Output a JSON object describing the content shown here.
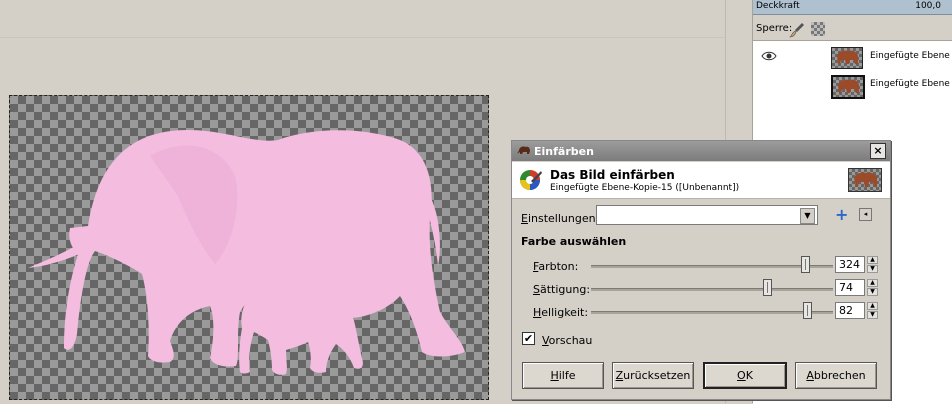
{
  "layers_panel": {
    "opacity_label": "Deckkraft",
    "opacity_value": "100,0",
    "lock_label": "Sperre:",
    "layers": [
      {
        "name": "Eingefügte Ebene",
        "visible": true
      },
      {
        "name": "Eingefügte Ebene",
        "visible": false
      }
    ]
  },
  "dialog": {
    "window_title": "Einfärben",
    "close_label": "×",
    "header_title": "Das Bild einfärben",
    "header_subtitle": "Eingefügte Ebene-Kopie-15 ([Unbenannt])",
    "settings_label_pre": "",
    "settings_label_mnemonic": "E",
    "settings_label_post": "instellungen:",
    "settings_value": "",
    "section_title": "Farbe auswählen",
    "sliders": [
      {
        "key": "hue",
        "mnemonic": "F",
        "rest": "arbton:",
        "value": "324",
        "min": 0,
        "max": 360
      },
      {
        "key": "saturation",
        "mnemonic": "S",
        "rest": "ättigung:",
        "value": "74",
        "min": 0,
        "max": 100
      },
      {
        "key": "lightness",
        "mnemonic": "H",
        "rest": "elligkeit:",
        "value": "82",
        "min": -100,
        "max": 100
      }
    ],
    "preview_mnemonic": "V",
    "preview_rest": "orschau",
    "preview_checked": true,
    "buttons": {
      "help_mnemonic": "H",
      "help_rest": "ilfe",
      "reset_mnemonic": "Z",
      "reset_rest": "urücksetzen",
      "ok_mnemonic": "O",
      "ok_rest": "K",
      "cancel_mnemonic": "A",
      "cancel_rest": "bbrechen"
    }
  },
  "colors": {
    "elephant_pink": "#f4bde0",
    "titlebar": "#8a8a8a",
    "accent_blue": "#2c68c7"
  },
  "icons": {
    "close": "close-icon",
    "eye": "eye-icon",
    "brush": "brush-lock-icon",
    "alpha": "alpha-lock-icon",
    "colorize": "colorize-icon",
    "add": "add-preset-icon",
    "menu": "preset-menu-icon"
  }
}
